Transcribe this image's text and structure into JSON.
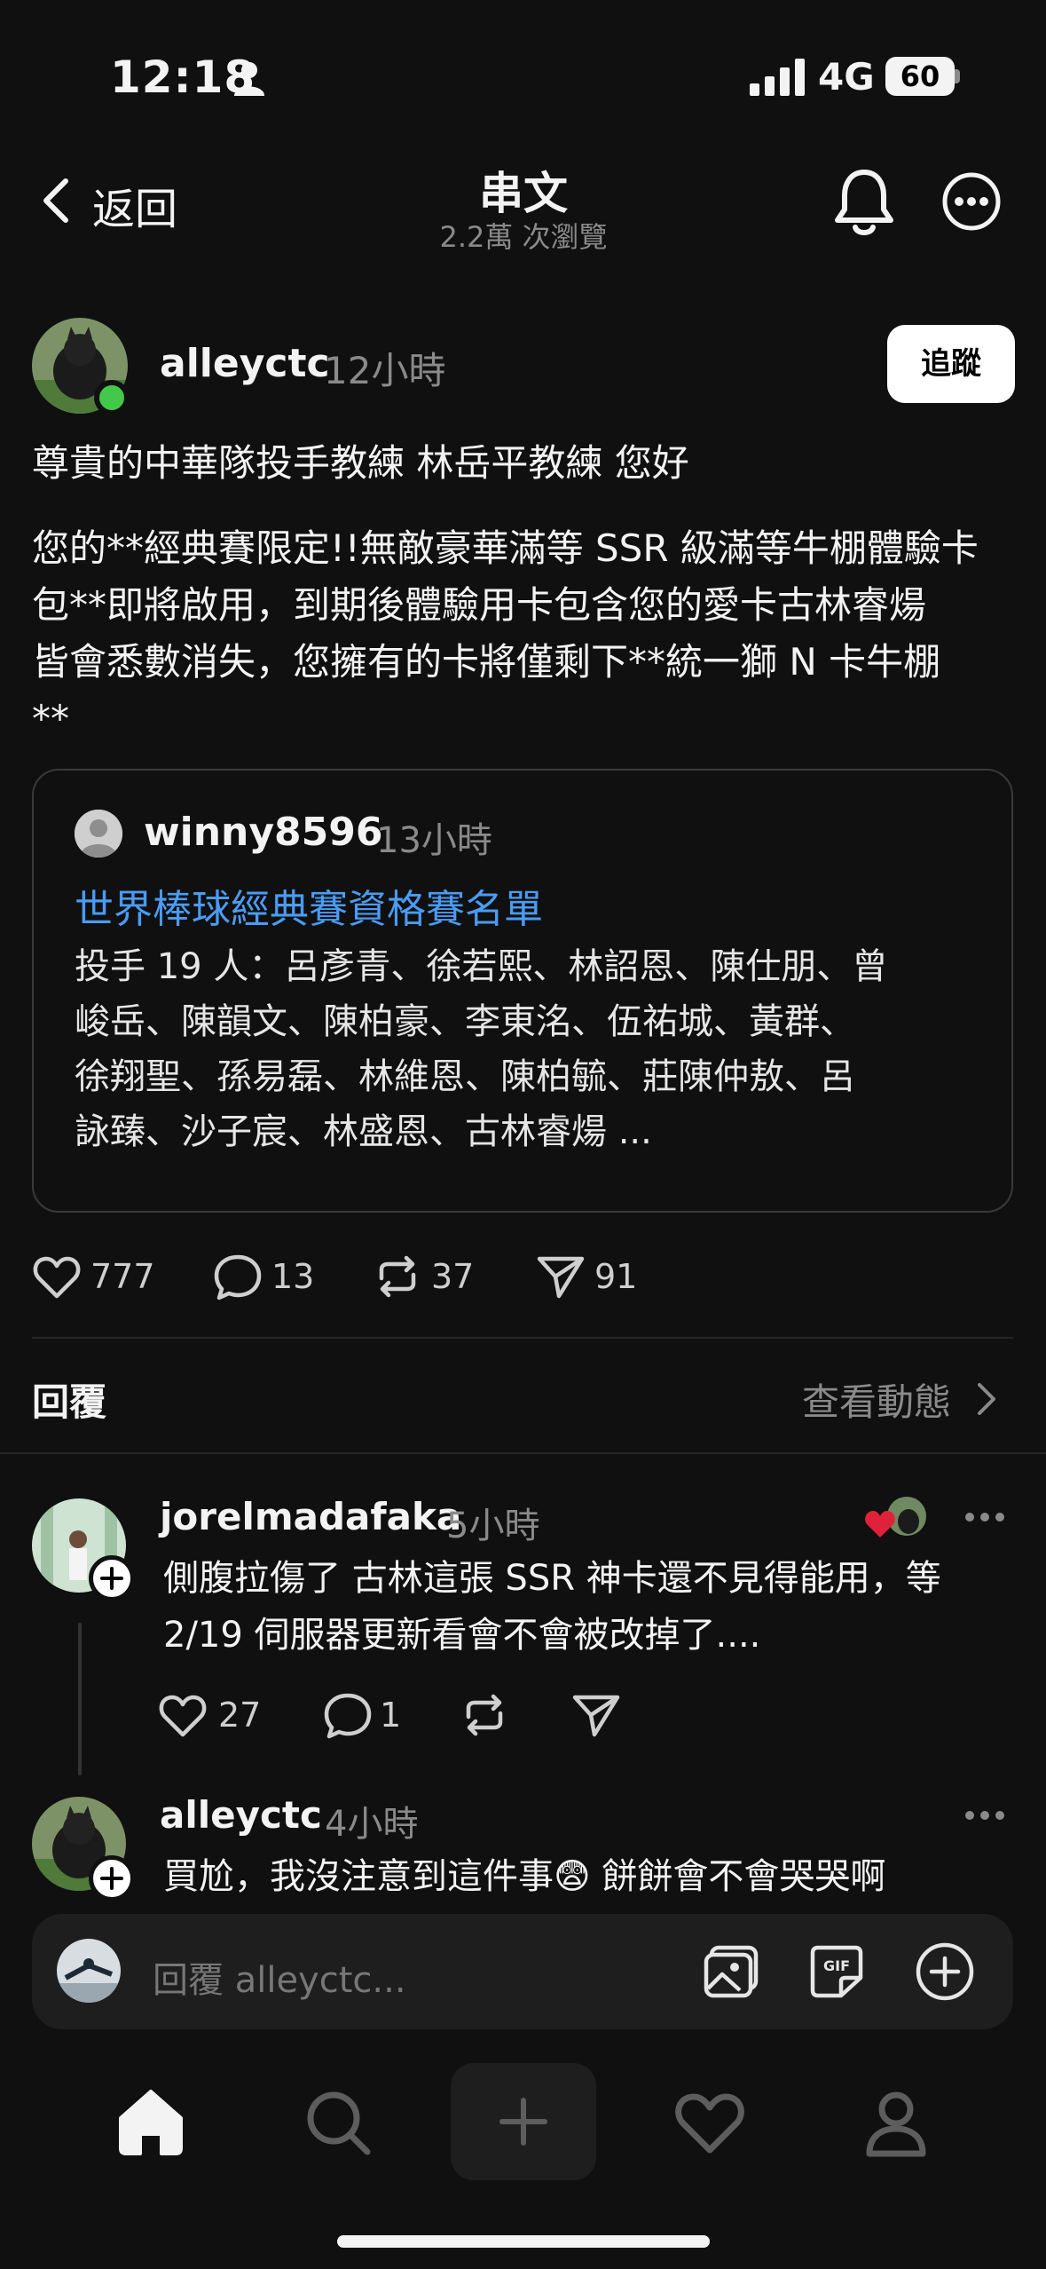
{
  "status_bar": {
    "time": "12:18",
    "network": "4G",
    "battery": "60"
  },
  "header": {
    "back_label": "返回",
    "title": "串文",
    "views": "2.2萬 次瀏覽"
  },
  "post": {
    "username": "alleyctc",
    "time": "12小時",
    "follow_label": "追蹤",
    "text_lines": [
      "尊貴的中華隊投手教練 林岳平教練 您好",
      "您的**經典賽限定!!無敵豪華滿等 SSR 級滿等牛棚體驗卡",
      "包**即將啟用，到期後體驗用卡包含您的愛卡古林睿煬",
      "皆會悉數消失，您擁有的卡將僅剩下**統一獅 N 卡牛棚",
      "**"
    ],
    "quote": {
      "username": "winny8596",
      "time": "13小時",
      "title": "世界棒球經典賽資格賽名單",
      "body_lines": [
        "投手 19 人：呂彥青、徐若熙、林詔恩、陳仕朋、曾",
        "峻岳、陳韻文、陳柏豪、李東洺、伍祐城、黃群、",
        "徐翔聖、孫易磊、林維恩、陳柏毓、莊陳仲敖、呂",
        "詠臻、沙子宸、林盛恩、古林睿煬 ..."
      ]
    },
    "stats": {
      "likes": "777",
      "comments": "13",
      "reposts": "37",
      "shares": "91"
    }
  },
  "replies_section": {
    "label": "回覆",
    "activity_link": "查看動態"
  },
  "replies": [
    {
      "username": "jorelmadafaka",
      "time": "5小時",
      "text_lines": [
        "側腹拉傷了 古林這張 SSR 神卡還不見得能用，等",
        "2/19 伺服器更新看會不會被改掉了...."
      ],
      "likes": "27",
      "comments": "1"
    },
    {
      "username": "alleyctc",
      "time": "4小時",
      "text_lines": [
        "買尬，我沒注意到這件事😨 餅餅會不會哭哭啊"
      ]
    }
  ],
  "reply_bar": {
    "placeholder": "回覆 alleyctc..."
  },
  "colors": {
    "background": "#101010",
    "link": "#4a9cf5",
    "online": "#42c94a",
    "like_heart": "#e0213a"
  }
}
